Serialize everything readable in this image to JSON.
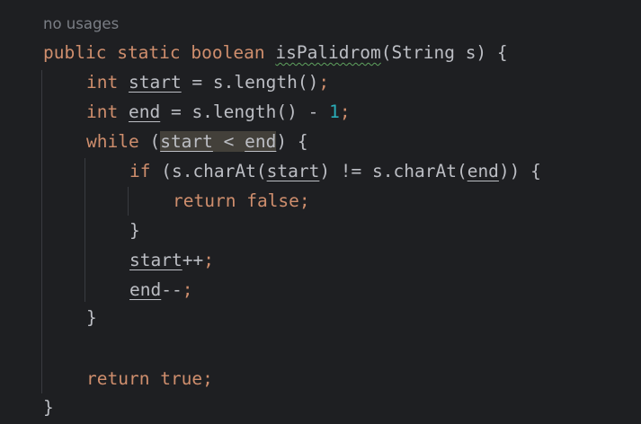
{
  "editor": {
    "truncated_top": "           ",
    "usage_hint": "no usages",
    "lines": {
      "l1": {
        "kw1": "public",
        "kw2": "static",
        "kw3": "boolean",
        "method": "isPalidrom",
        "open": "(",
        "type": "String",
        "param": " s) {"
      },
      "l2": {
        "kw": "int",
        "var": "start",
        "rest": " = s.length()",
        "semi": ";"
      },
      "l3": {
        "kw": "int",
        "var": "end",
        "rest": " = s.length() - ",
        "num": "1",
        "semi": ";"
      },
      "l4": {
        "kw": "while",
        "open": "(",
        "var1": "start",
        "op": " < ",
        "var2": "end",
        "close": ")",
        "brace": " {"
      },
      "l5": {
        "kw": "if",
        "p1": " (s.charAt(",
        "var1": "start",
        "p2": ") != s.charAt(",
        "var2": "end",
        "p3": ")) {"
      },
      "l6": {
        "kw": "return",
        "val": "false",
        "semi": ";"
      },
      "l7": {
        "brace": "}"
      },
      "l8": {
        "var": "start",
        "op": "++",
        "semi": ";"
      },
      "l9": {
        "var": "end",
        "op": "--",
        "semi": ";"
      },
      "l10": {
        "brace": "}"
      },
      "l11": {
        "kw": "return",
        "val": "true",
        "semi": ";"
      },
      "l12": {
        "brace": "}"
      }
    }
  },
  "colors": {
    "background": "#1e1f22",
    "keyword": "#cf8e6d",
    "number": "#2aacb8",
    "text": "#bcbec4",
    "hint": "#7a7e85",
    "match_highlight": "#43403a",
    "typo_underline": "#5fa35f"
  }
}
